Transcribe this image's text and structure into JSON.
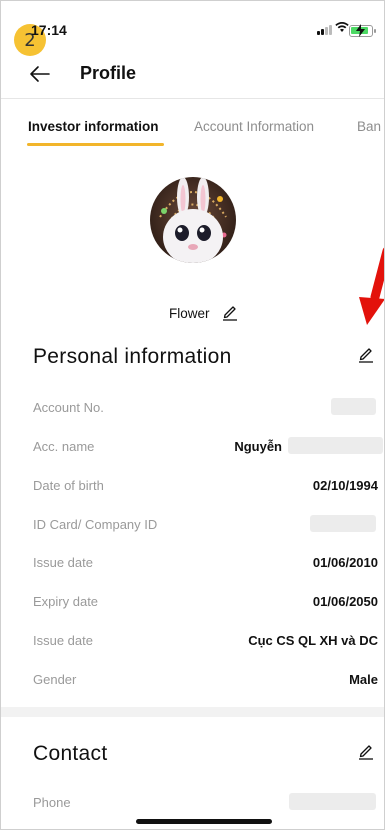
{
  "status_bar": {
    "time": "17:14",
    "badge": "2"
  },
  "header": {
    "title": "Profile"
  },
  "tabs": [
    {
      "label": "Investor information",
      "active": true
    },
    {
      "label": "Account Information",
      "active": false
    },
    {
      "label": "Ban",
      "active": false
    }
  ],
  "profile": {
    "display_name": "Flower"
  },
  "personal": {
    "title": "Personal information",
    "rows": [
      {
        "label": "Account No.",
        "value": ""
      },
      {
        "label": "Acc. name",
        "value": "Nguyễn"
      },
      {
        "label": "Date of birth",
        "value": "02/10/1994"
      },
      {
        "label": "ID Card/ Company ID",
        "value": ""
      },
      {
        "label": "Issue date",
        "value": "01/06/2010"
      },
      {
        "label": "Expiry date",
        "value": "01/06/2050"
      },
      {
        "label": "Issue date",
        "value": "Cục CS QL XH và DC"
      },
      {
        "label": "Gender",
        "value": "Male"
      }
    ]
  },
  "contact": {
    "title": "Contact",
    "rows": [
      {
        "label": "Phone",
        "value": ""
      }
    ]
  },
  "colors": {
    "accent": "#f2b52a",
    "badge": "#f6c233",
    "annotation_arrow": "#e3120b"
  }
}
